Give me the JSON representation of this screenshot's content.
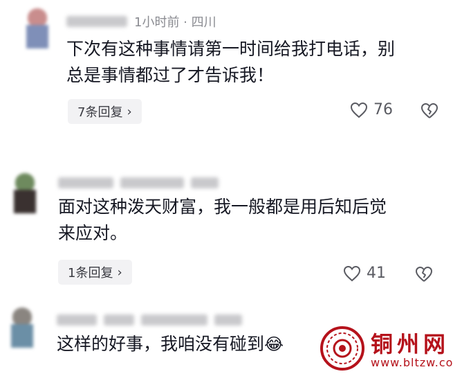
{
  "comments": [
    {
      "meta": "1小时前 · 四川",
      "text_line1": "下次有这种事情请第一时间给我打电话，别",
      "text_line2": "总是事情都过了才告诉我！",
      "reply_label": "7条回复",
      "likes": "76"
    },
    {
      "text_line1": "面对这种泼天财富，我一般都是用后知后觉",
      "text_line2": "来应对。",
      "reply_label": "1条回复",
      "likes": "41"
    },
    {
      "text_line1": "这样的好事，我咱没有碰到",
      "emoji": "😂"
    }
  ],
  "watermark": {
    "name": "铜州网",
    "url": "www.bltzw.com"
  },
  "colors": {
    "accent": "#b5121b",
    "text": "#161823",
    "meta": "#8a8b91"
  }
}
